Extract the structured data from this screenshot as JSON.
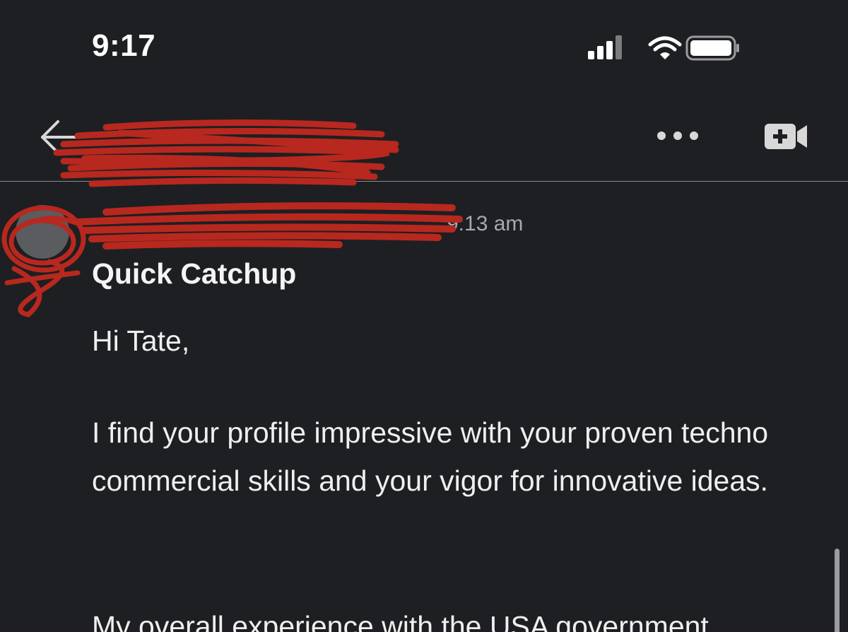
{
  "status_bar": {
    "time": "9:17",
    "icons": [
      "signal-icon",
      "wifi-icon",
      "battery-icon"
    ]
  },
  "header": {
    "title": "",
    "icons": [
      "back-arrow-icon",
      "more-icon",
      "add-video-call-icon"
    ]
  },
  "message": {
    "sender": "",
    "time": "9:13 am",
    "subject": "Quick Catchup",
    "greeting": "Hi Tate,",
    "paragraph_1": "I find your profile impressive with your proven techno commercial skills and your vigor for innovative ideas.",
    "paragraph_2": "My overall experience with the USA government"
  },
  "colors": {
    "background": "#1d1f23",
    "text": "#efefef",
    "muted_text": "#a7a9ad",
    "redaction": "#b8281e"
  }
}
